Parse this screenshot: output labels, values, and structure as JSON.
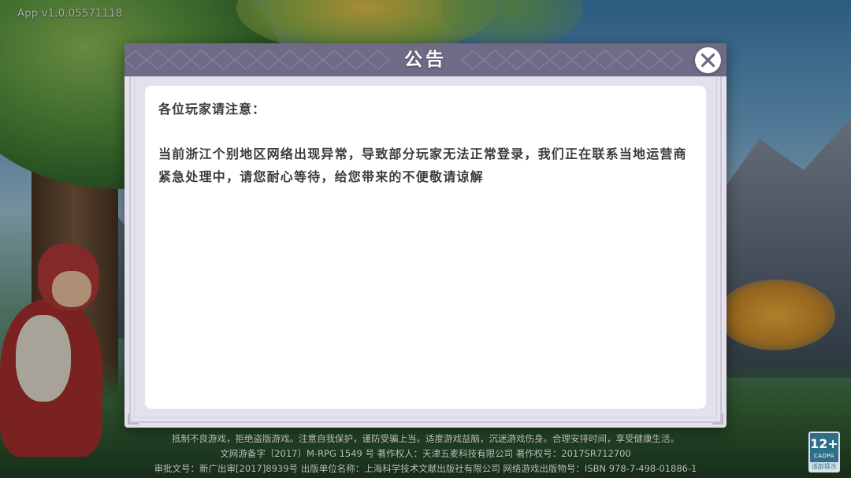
{
  "app_version": "App v1.0.05571118",
  "dialog": {
    "title": "公告",
    "greeting": "各位玩家请注意：",
    "message": "当前浙江个别地区网络出现异常，导致部分玩家无法正常登录，我们正在联系当地运营商紧急处理中，请您耐心等待，给您带来的不便敬请谅解"
  },
  "footer": {
    "line1": "抵制不良游戏，拒绝盗版游戏。注意自我保护，谨防受骗上当。适度游戏益脑，沉迷游戏伤身。合理安排时间，享受健康生活。",
    "line2": "文网游备字〔2017〕M-RPG 1549 号  著作权人：天津五麦科技有限公司  著作权号：2017SR712700",
    "line3": "审批文号：新广出审[2017]8939号  出版单位名称：上海科学技术文献出版社有限公司  网络游戏出版物号：ISBN 978-7-498-01886-1"
  },
  "age_badge": {
    "rating": "12+",
    "org": "CADPA",
    "tip": "适龄提示"
  },
  "icons": {
    "close": "close-icon"
  },
  "colors": {
    "header": "#6f6a86",
    "dialog_frame": "#e4e1ec",
    "panel": "#ffffff",
    "text": "#3c3c3c"
  }
}
